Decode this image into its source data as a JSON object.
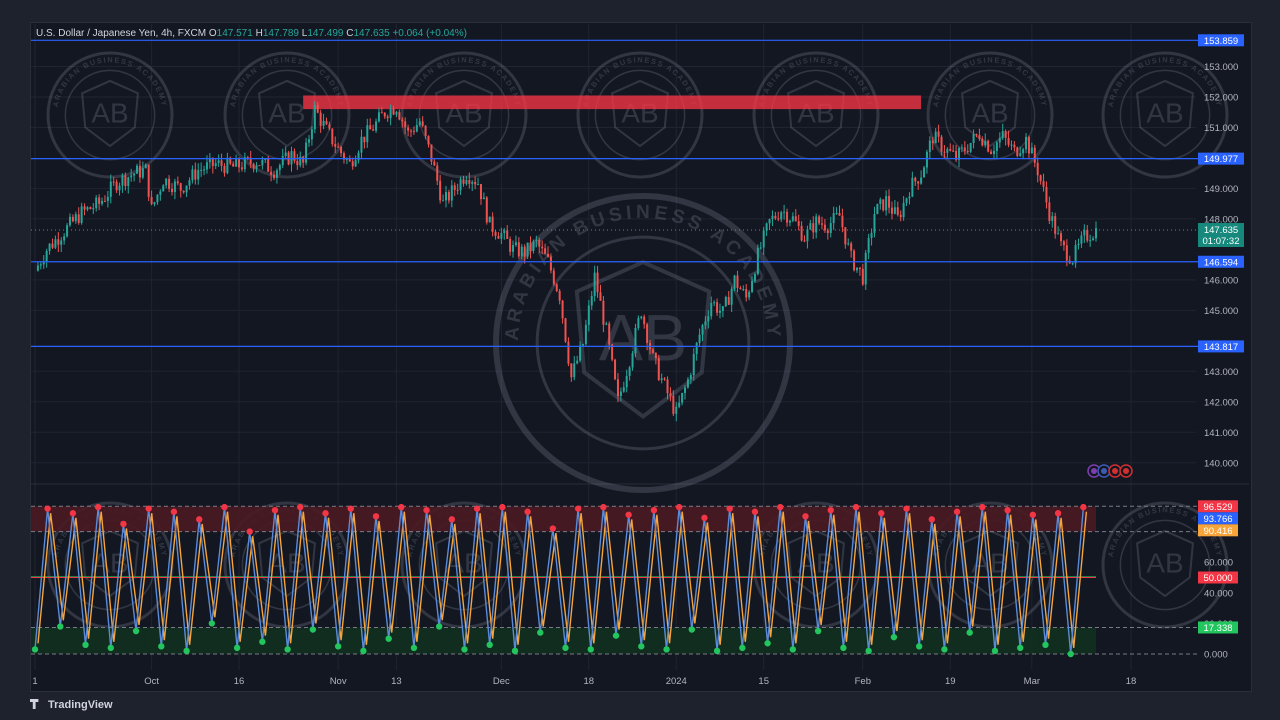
{
  "header": {
    "symbol": "U.S. Dollar / Japanese Yen, 4h, FXCM",
    "o_label": "O",
    "o_value": "147.571",
    "h_label": "H",
    "h_value": "147.789",
    "l_label": "L",
    "l_value": "147.499",
    "c_label": "C",
    "c_value": "147.635",
    "change": "+0.064 (+0.04%)"
  },
  "branding": {
    "text": "TradingView"
  },
  "watermark": {
    "text": "ARABIAN BUSINESS ACADEMY",
    "monogram": "AB"
  },
  "colors": {
    "background": "#131722",
    "grid": "#1f2430",
    "up": "#26a69a",
    "down": "#ef5350",
    "level_line": "#2962ff",
    "resistance_zone": "#f23645",
    "osc_k": "#5b8bd8",
    "osc_d": "#f7a53a",
    "overbought_zone": "#4a1a22",
    "oversold_zone": "#12301f"
  },
  "chart_data": [
    {
      "type": "candlestick",
      "title": "U.S. Dollar / Japanese Yen, 4h, FXCM",
      "ylim": [
        139.5,
        154.0
      ],
      "y_ticks": [
        "140.000",
        "141.000",
        "142.000",
        "143.000",
        "145.000",
        "146.000",
        "148.000",
        "149.000",
        "151.000",
        "152.000",
        "153.000"
      ],
      "x_ticks": [
        "1",
        "Oct",
        "16",
        "Nov",
        "13",
        "Dec",
        "18",
        "2024",
        "15",
        "Feb",
        "19",
        "Mar",
        "18"
      ],
      "x_tick_index": [
        0,
        20,
        35,
        52,
        62,
        80,
        95,
        110,
        125,
        142,
        157,
        171,
        188
      ],
      "last_price": "147.635",
      "countdown": "01:07:32",
      "horizontal_levels": [
        {
          "label": "153.859",
          "value": 153.859
        },
        {
          "label": "149.977",
          "value": 149.977
        },
        {
          "label": "146.594",
          "value": 146.594
        },
        {
          "label": "143.817",
          "value": 143.817
        }
      ],
      "resistance_zone": {
        "low": 151.7,
        "high": 151.95,
        "start_index": 46,
        "end_index": 152
      },
      "close_path": [
        [
          0,
          146.3
        ],
        [
          2,
          147.0
        ],
        [
          5,
          147.6
        ],
        [
          8,
          148.2
        ],
        [
          11,
          148.5
        ],
        [
          14,
          149.2
        ],
        [
          17,
          149.5
        ],
        [
          19,
          149.6
        ],
        [
          20,
          148.3
        ],
        [
          22,
          149.3
        ],
        [
          25,
          149.0
        ],
        [
          28,
          149.6
        ],
        [
          31,
          149.8
        ],
        [
          34,
          149.7
        ],
        [
          38,
          149.9
        ],
        [
          41,
          149.6
        ],
        [
          44,
          150.1
        ],
        [
          46,
          149.8
        ],
        [
          48,
          151.6
        ],
        [
          50,
          150.9
        ],
        [
          52,
          150.3
        ],
        [
          54,
          149.8
        ],
        [
          56,
          150.6
        ],
        [
          58,
          151.0
        ],
        [
          60,
          151.5
        ],
        [
          62,
          151.7
        ],
        [
          64,
          150.8
        ],
        [
          66,
          151.2
        ],
        [
          68,
          150.0
        ],
        [
          70,
          148.5
        ],
        [
          72,
          149.0
        ],
        [
          74,
          149.5
        ],
        [
          76,
          149.2
        ],
        [
          78,
          147.8
        ],
        [
          80,
          147.5
        ],
        [
          82,
          147.0
        ],
        [
          84,
          146.9
        ],
        [
          86,
          147.2
        ],
        [
          88,
          146.6
        ],
        [
          90,
          145.5
        ],
        [
          92,
          142.8
        ],
        [
          94,
          143.9
        ],
        [
          96,
          146.1
        ],
        [
          98,
          144.3
        ],
        [
          100,
          142.0
        ],
        [
          102,
          143.4
        ],
        [
          104,
          145.0
        ],
        [
          106,
          143.4
        ],
        [
          108,
          142.5
        ],
        [
          110,
          141.6
        ],
        [
          112,
          142.7
        ],
        [
          114,
          144.2
        ],
        [
          116,
          145.3
        ],
        [
          118,
          144.9
        ],
        [
          120,
          146.0
        ],
        [
          122,
          145.4
        ],
        [
          124,
          146.8
        ],
        [
          126,
          147.9
        ],
        [
          128,
          148.3
        ],
        [
          130,
          148.0
        ],
        [
          132,
          147.4
        ],
        [
          134,
          147.9
        ],
        [
          136,
          147.8
        ],
        [
          138,
          148.1
        ],
        [
          140,
          146.7
        ],
        [
          142,
          146.1
        ],
        [
          144,
          148.2
        ],
        [
          146,
          148.6
        ],
        [
          148,
          148.0
        ],
        [
          150,
          149.0
        ],
        [
          152,
          149.5
        ],
        [
          154,
          150.7
        ],
        [
          156,
          150.3
        ],
        [
          158,
          150.0
        ],
        [
          160,
          150.4
        ],
        [
          162,
          150.8
        ],
        [
          164,
          150.3
        ],
        [
          166,
          150.7
        ],
        [
          168,
          150.2
        ],
        [
          170,
          150.6
        ],
        [
          172,
          149.6
        ],
        [
          174,
          148.2
        ],
        [
          176,
          147.1
        ],
        [
          178,
          146.7
        ],
        [
          180,
          147.4
        ],
        [
          182,
          147.635
        ]
      ]
    },
    {
      "type": "line",
      "title": "Oscillator",
      "ylim": [
        0,
        100
      ],
      "y_ticks": [
        "0.000",
        "20.000",
        "40.000",
        "60.000",
        "80.000"
      ],
      "overbought_band": [
        80,
        96.529
      ],
      "oversold_band": [
        0,
        17.338
      ],
      "mid_line": 50,
      "value_labels": [
        {
          "label": "96.529",
          "value": 96.529,
          "color": "#f23645"
        },
        {
          "label": "93.766",
          "value": 93.766,
          "color": "#2962ff"
        },
        {
          "label": "90.416",
          "value": 90.416,
          "color": "#f7a53a"
        },
        {
          "label": "50.000",
          "value": 50.0,
          "color": "#f23645"
        },
        {
          "label": "17.338",
          "value": 17.338,
          "color": "#22c55e"
        }
      ],
      "cycle_peaks": [
        95,
        92,
        96,
        85,
        95,
        93,
        88,
        96,
        80,
        94,
        96,
        92,
        95,
        90,
        96,
        94,
        88,
        95,
        96,
        93,
        82,
        95,
        96,
        91,
        94,
        96,
        89,
        95,
        93,
        96,
        90,
        94,
        96,
        92,
        95,
        88,
        93,
        96,
        94,
        91,
        92,
        96
      ],
      "cycle_troughs": [
        3,
        18,
        6,
        4,
        15,
        5,
        2,
        20,
        4,
        8,
        3,
        16,
        5,
        2,
        10,
        4,
        18,
        3,
        6,
        2,
        14,
        4,
        3,
        12,
        5,
        3,
        16,
        2,
        4,
        7,
        3,
        15,
        4,
        2,
        11,
        5,
        3,
        14,
        2,
        4,
        6,
        0
      ]
    }
  ]
}
